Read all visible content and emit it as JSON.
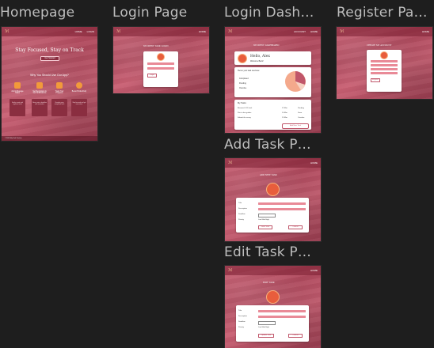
{
  "frames": {
    "homepage": {
      "title": "Homepage",
      "logo": "ℳ",
      "nav": [
        "HOME",
        "LOGIN"
      ],
      "hero": "Stay Focused, Stay on Track",
      "hero_button": "Get Started",
      "why": "Why You Should Use Our App?",
      "features": [
        {
          "icon": "calendar-icon",
          "label": "Add & Manage Tasks",
          "text": "Easily create and organize tasks"
        },
        {
          "icon": "check-icon",
          "label": "Set Reminders & Get Notifications",
          "text": "Never miss a deadline with reminders"
        },
        {
          "icon": "chart-icon",
          "label": "Track Your Progress",
          "text": "Visualize your completed work"
        },
        {
          "icon": "clock-icon",
          "label": "Boost Productivity",
          "text": "Stay focused and get more done"
        }
      ],
      "footer": "© 2025 My Task Tracker"
    },
    "login": {
      "title": "Login Page",
      "logo": "ℳ",
      "nav": [
        "HOME"
      ],
      "heading": "STUDENT TASK LOGIN",
      "button": "Login"
    },
    "dashboard": {
      "title": "Login Dash…",
      "logo": "ℳ",
      "nav": [
        "ACCOUNT",
        "HOME"
      ],
      "heading": "STUDENT DASHBOARD",
      "greeting": "Hello, Alex",
      "subgreeting": "Welcome Back!",
      "summary_title": "Here's your task overview",
      "summary_items": [
        "Completed",
        "Pending",
        "Overdue"
      ],
      "tasks_title": "My Tasks",
      "tasks": [
        {
          "name": "Research 101 task",
          "date": "12 Mar",
          "status": "Pending"
        },
        {
          "name": "Print a few guides",
          "date": "14 Mar",
          "status": "Done"
        },
        {
          "name": "Submit the essay",
          "date": "15 Mar",
          "status": "Overdue"
        }
      ],
      "add_button": "Add New Task"
    },
    "register": {
      "title": "Register Pa…",
      "logo": "ℳ",
      "nav": [
        "HOME"
      ],
      "heading": "CREATE MY ACCOUNT",
      "button": "Register"
    },
    "add_task": {
      "title": "Add Task P…",
      "logo": "ℳ",
      "nav": [
        "HOME"
      ],
      "heading": "ADD NEW TASK",
      "fields": [
        "Title",
        "Description",
        "Deadline",
        "Priority"
      ],
      "priority_options": "Low Med High",
      "buttons": [
        "Save Task",
        "Cancel"
      ]
    },
    "edit_task": {
      "title": "Edit Task P…",
      "logo": "ℳ",
      "nav": [
        "HOME"
      ],
      "heading": "EDIT TASK",
      "fields": [
        "Title",
        "Description",
        "Deadline",
        "Priority"
      ],
      "priority_options": "Low Med High",
      "buttons": [
        "Update Task",
        "Cancel"
      ]
    }
  }
}
